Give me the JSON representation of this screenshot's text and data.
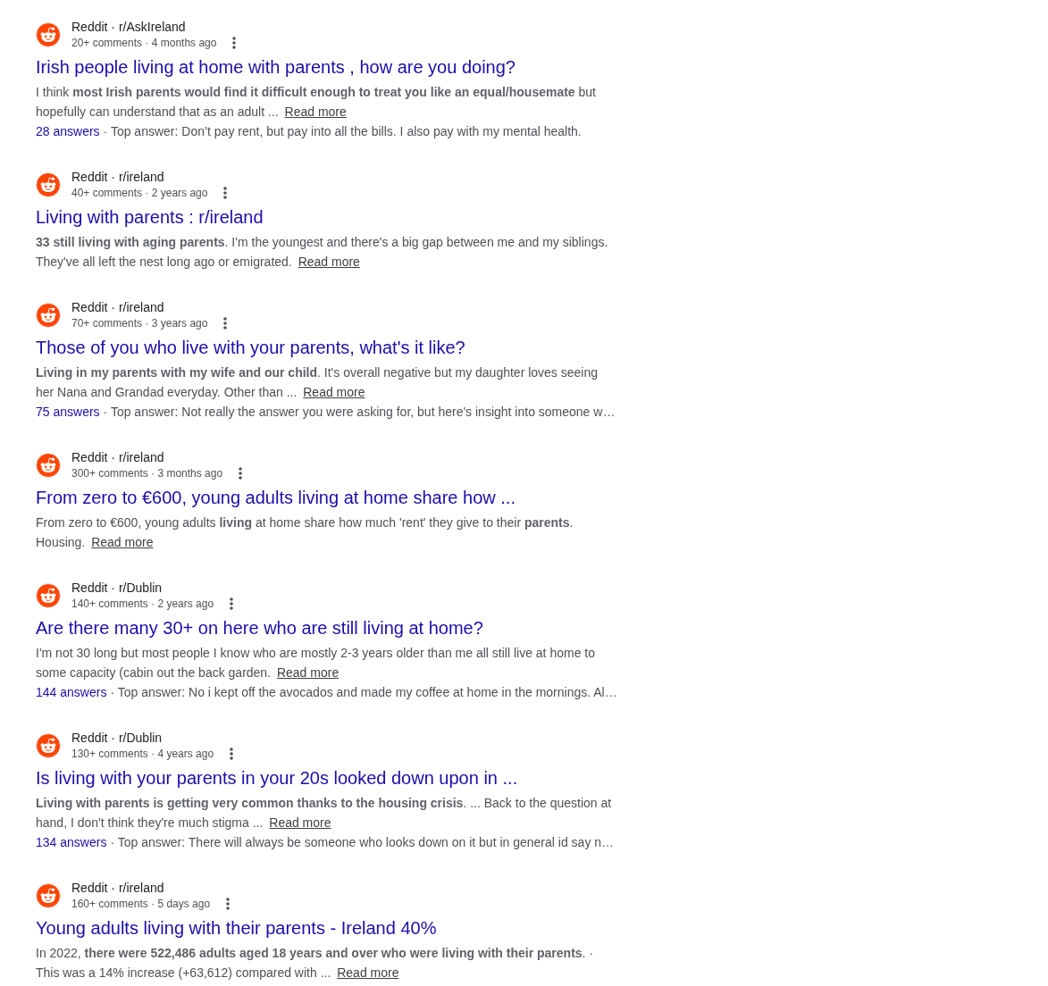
{
  "results": [
    {
      "source": "Reddit · r/AskIreland",
      "meta": "20+ comments · 4 months ago",
      "title": "Irish people living at home with parents , how are you doing?",
      "snippet": "I think **most Irish parents would find it difficult enough to treat you like an equal/housemate** but hopefully can understand that as an adult ...",
      "read_more": "Read more",
      "answers": "28 answers",
      "top_answer": "· Top answer: Don’t pay rent, but pay into all the bills. I also pay with my mental health."
    },
    {
      "source": "Reddit · r/ireland",
      "meta": "40+ comments · 2 years ago",
      "title": "Living with parents : r/ireland",
      "snippet": "**33 still living with aging parents**. I'm the youngest and there's a big gap between me and my siblings. They've all left the nest long ago or emigrated.",
      "read_more": "Read more"
    },
    {
      "source": "Reddit · r/ireland",
      "meta": "70+ comments · 3 years ago",
      "title": "Those of you who live with your parents, what's it like?",
      "snippet": "**Living in my parents with my wife and our child**. It's overall negative but my daughter loves seeing her Nana and Grandad everyday. Other than ...",
      "read_more": "Read more",
      "answers": "75 answers",
      "top_answer": "· Top answer: Not really the answer you were asking for, but here's insight into someone w…"
    },
    {
      "source": "Reddit · r/ireland",
      "meta": "300+ comments · 3 months ago",
      "title": "From zero to €600, young adults living at home share how ...",
      "snippet": "From zero to €600, young adults **living** at home share how much 'rent' they give to their **parents**. Housing.",
      "read_more": "Read more"
    },
    {
      "source": "Reddit · r/Dublin",
      "meta": "140+ comments · 2 years ago",
      "title": "Are there many 30+ on here who are still living at home?",
      "snippet": "I'm not 30 long but most people I know who are mostly 2-3 years older than me all still live at home to some capacity (cabin out the back garden.",
      "read_more": "Read more",
      "answers": "144 answers",
      "top_answer": "· Top answer: No i kept off the avocados and made my coffee at home in the mornings. Al…"
    },
    {
      "source": "Reddit · r/Dublin",
      "meta": "130+ comments · 4 years ago",
      "title": "Is living with your parents in your 20s looked down upon in ...",
      "snippet": "**Living with parents is getting very common thanks to the housing crisis**. ... Back to the question at hand, I don't think they're much stigma ...",
      "read_more": "Read more",
      "answers": "134 answers",
      "top_answer": "· Top answer: There will always be someone who looks down on it but in general id say n…"
    },
    {
      "source": "Reddit · r/ireland",
      "meta": "160+ comments · 5 days ago",
      "title": "Young adults living with their parents - Ireland 40%",
      "snippet": "In 2022, **there were 522,486 adults aged 18 years and over who were living with their parents**. · This was a 14% increase (+63,612) compared with ...",
      "read_more": "Read more"
    }
  ]
}
